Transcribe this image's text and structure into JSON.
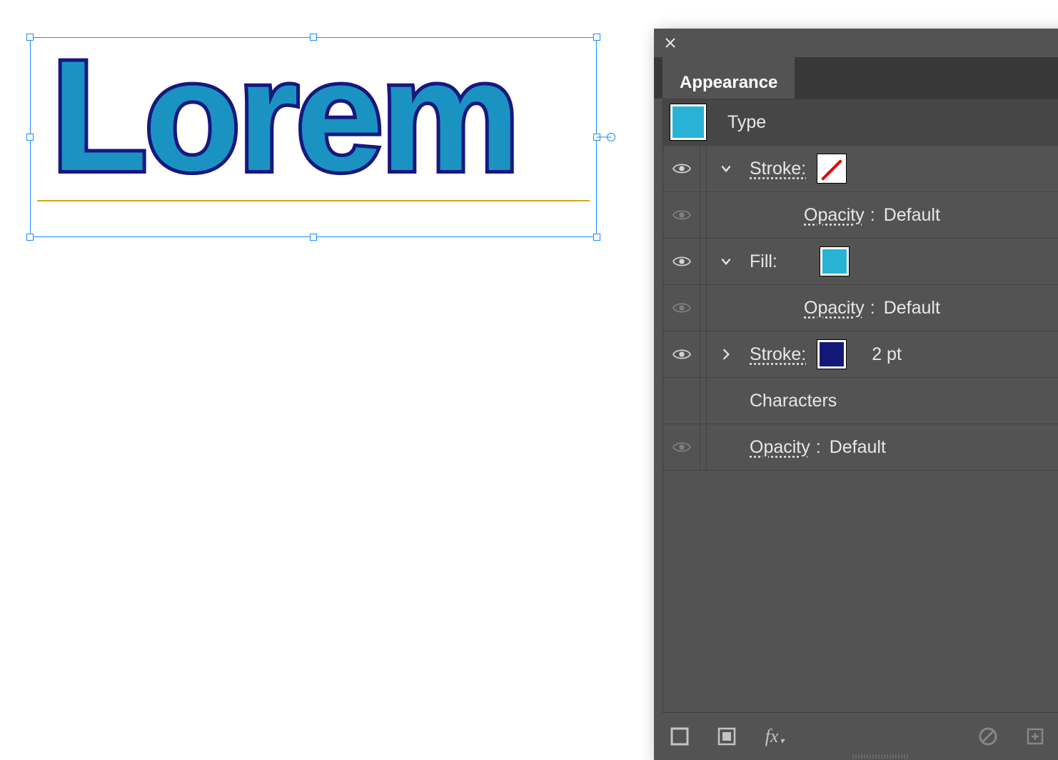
{
  "canvas": {
    "text": "Lorem",
    "fill_color": "#1b93c2",
    "stroke_color": "#16187f"
  },
  "panel": {
    "title": "Appearance",
    "type_row": {
      "label": "Type",
      "thumb_color": "#28B3D6"
    },
    "rows": [
      {
        "kind": "stroke",
        "label": "Stroke:",
        "swatch": "none",
        "expanded": true,
        "visible": true
      },
      {
        "kind": "opacity",
        "label": "Opacity",
        "value": "Default",
        "visible": false
      },
      {
        "kind": "fill",
        "label": "Fill:",
        "swatch": "#28B3D6",
        "expanded": true,
        "visible": true
      },
      {
        "kind": "opacity",
        "label": "Opacity",
        "value": "Default",
        "visible": false
      },
      {
        "kind": "stroke2",
        "label": "Stroke:",
        "swatch": "#161878",
        "value": "2 pt",
        "expanded": false,
        "visible": true
      },
      {
        "kind": "characters",
        "label": "Characters"
      },
      {
        "kind": "opacity",
        "label": "Opacity",
        "value": "Default",
        "visible": false
      }
    ]
  }
}
